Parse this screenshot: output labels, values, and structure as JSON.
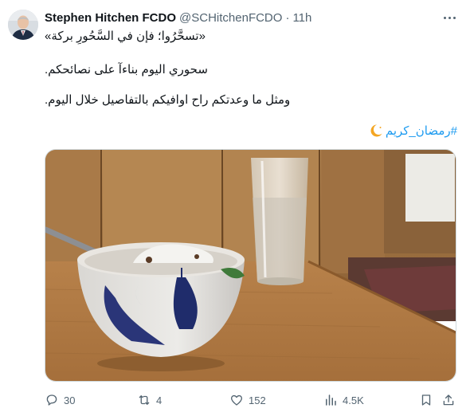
{
  "tweet": {
    "author_name": "Stephen Hitchen FCDO",
    "handle": "@SCHitchenFCDO",
    "separator": "·",
    "time": "11h",
    "lines": [
      "«تسحَّرُوا؛ فإن في السَّحُورِ بركة»",
      "سحوري اليوم بناءآ على نصائحكم.",
      "ومثل ما وعدتكم راح اوافيكم بالتفاصيل خلال اليوم."
    ],
    "hashtag": "#رمضان_كريم",
    "hashtag_emoji": "crescent-moon-icon"
  },
  "actions": {
    "replies": "30",
    "reposts": "4",
    "likes": "152",
    "views": "4.5K"
  },
  "colors": {
    "link": "#1d9bf0",
    "secondary_text": "#536471",
    "primary_text": "#0f1419",
    "border": "#cfd9de"
  }
}
